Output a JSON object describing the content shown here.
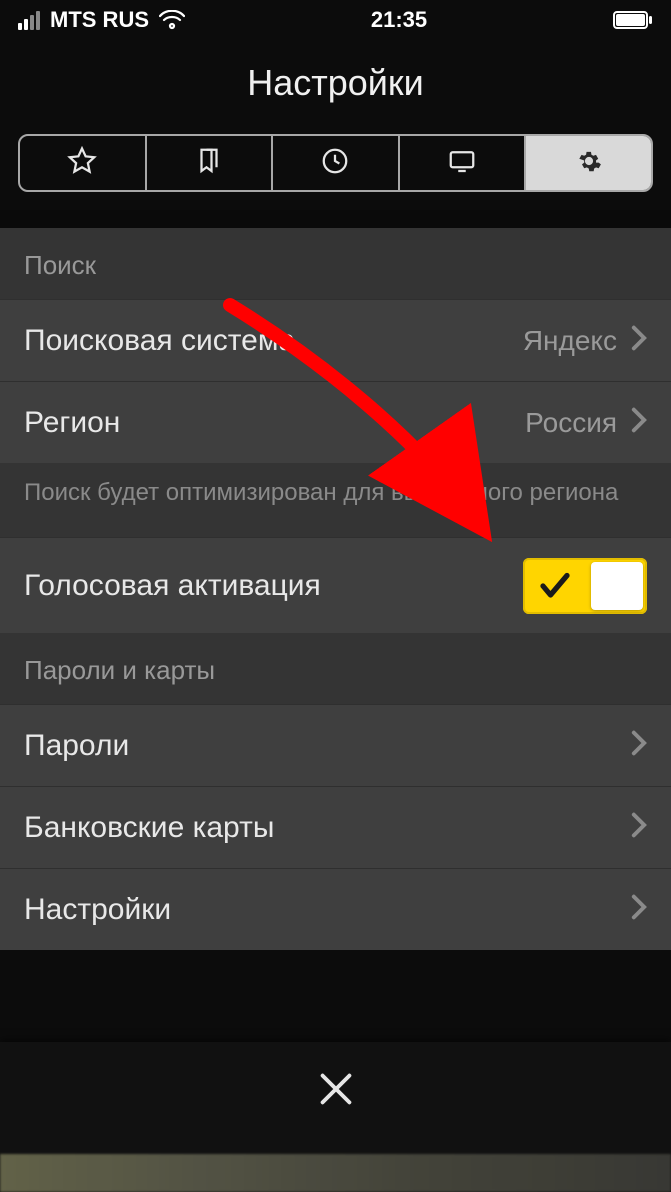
{
  "status": {
    "carrier": "MTS RUS",
    "time": "21:35"
  },
  "header": {
    "title": "Настройки"
  },
  "sections": {
    "search": {
      "header": "Поиск",
      "engine_label": "Поисковая система",
      "engine_value": "Яндекс",
      "region_label": "Регион",
      "region_value": "Россия",
      "footer": "Поиск будет оптимизирован для выбранного региона",
      "voice_label": "Голосовая активация"
    },
    "passwords": {
      "header": "Пароли и карты",
      "passwords_label": "Пароли",
      "cards_label": "Банковские карты",
      "settings_label": "Настройки"
    }
  },
  "toggle": {
    "voice_on": true
  },
  "colors": {
    "accent": "#ffd500",
    "arrow": "#ff0000"
  }
}
